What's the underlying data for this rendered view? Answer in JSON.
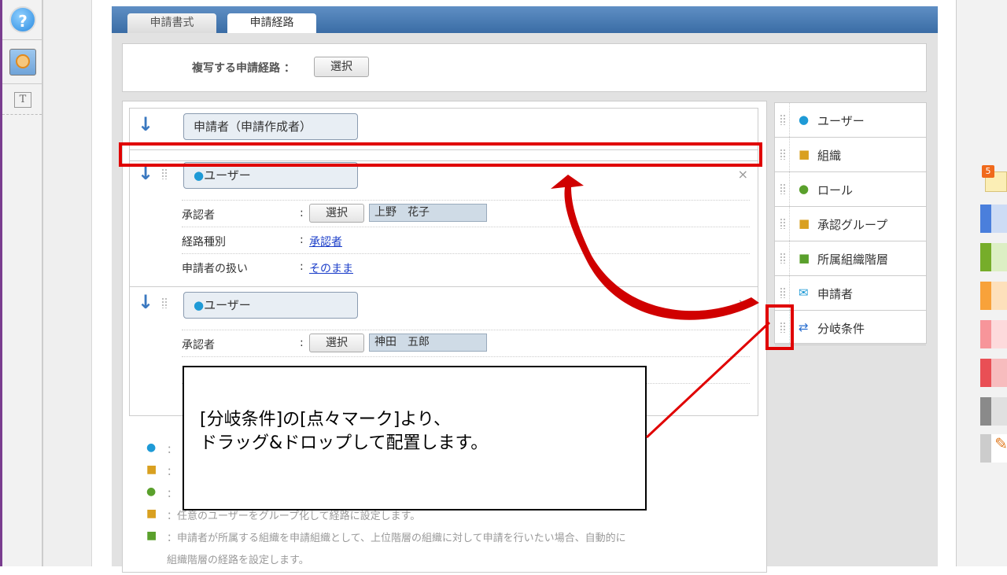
{
  "left_toolbar": {
    "items": [
      {
        "icon": "help-icon"
      },
      {
        "icon": "support-operator-icon"
      },
      {
        "icon": "text-icon",
        "glyph": "T"
      }
    ]
  },
  "tabs": [
    {
      "label": "申請書式",
      "active": false
    },
    {
      "label": "申請経路",
      "active": true
    }
  ],
  "copy_route": {
    "label": "複写する申請経路 ：",
    "button": "選択"
  },
  "route": {
    "applicant_node": "申請者（申請作成者）",
    "steps": [
      {
        "node": "ユーザー",
        "rows": [
          {
            "label": "承認者",
            "button": "選択",
            "value": "上野　花子"
          },
          {
            "label": "経路種別",
            "link": "承認者"
          },
          {
            "label": "申請者の扱い",
            "link": "そのまま"
          }
        ]
      },
      {
        "node": "ユーザー",
        "rows": [
          {
            "label": "承認者",
            "button": "選択",
            "value": "神田　五郎"
          }
        ]
      }
    ],
    "colon": ":",
    "close": "×"
  },
  "palette": {
    "items": [
      {
        "label": "ユーザー",
        "icon": "user-icon"
      },
      {
        "label": "組織",
        "icon": "organization-icon"
      },
      {
        "label": "ロール",
        "icon": "role-icon"
      },
      {
        "label": "承認グループ",
        "icon": "approval-group-icon"
      },
      {
        "label": "所属組織階層",
        "icon": "org-hierarchy-icon"
      },
      {
        "label": "申請者",
        "icon": "applicant-icon"
      },
      {
        "label": "分岐条件",
        "icon": "branch-icon"
      }
    ]
  },
  "legend": [
    {
      "icon": "user-icon",
      "text": "："
    },
    {
      "icon": "organization-icon",
      "text": "："
    },
    {
      "icon": "role-icon",
      "text": "："
    },
    {
      "icon": "approval-group-icon",
      "text": "：任意のユーザーをグループ化して経路に設定します。"
    },
    {
      "icon": "org-hierarchy-icon",
      "text": "：申請者が所属する組織を申請組織として、上位階層の組織に対して申請を行いたい場合、自動的に"
    },
    {
      "icon": "",
      "text": "組織階層の経路を設定します。"
    }
  ],
  "right_toolbar": {
    "badge": "5",
    "swatches": [
      {
        "dark": "#4a7fdc",
        "light": "#cddcf5"
      },
      {
        "dark": "#76ad2a",
        "light": "#dcefc4"
      },
      {
        "dark": "#f8a23a",
        "light": "#fde0bb"
      },
      {
        "dark": "#f7959a",
        "light": "#fddadc"
      },
      {
        "dark": "#e94f55",
        "light": "#f7bcbe"
      },
      {
        "dark": "#8a8a8a",
        "light": "#e0e0e0"
      }
    ]
  },
  "annotation": {
    "line1": "[分岐条件]の[点々マーク]より、",
    "line2": "ドラッグ&ドロップして配置します。",
    "color": "#e00000"
  }
}
